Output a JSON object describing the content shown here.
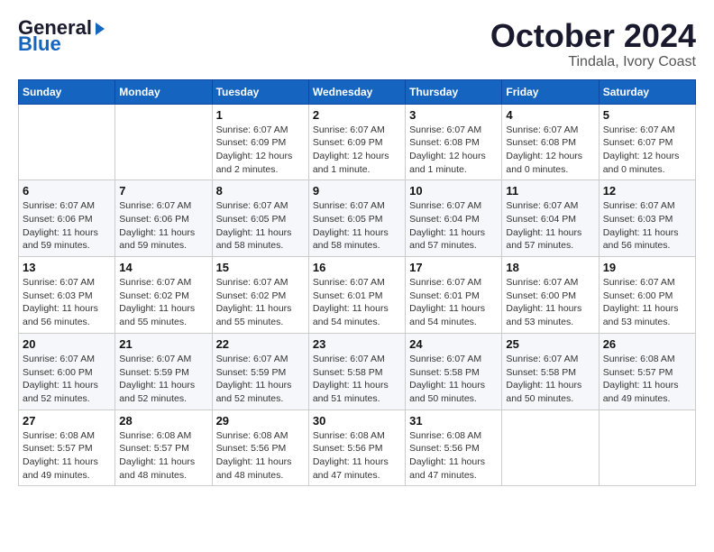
{
  "header": {
    "logo_line1": "General",
    "logo_line2": "Blue",
    "month_title": "October 2024",
    "location": "Tindala, Ivory Coast"
  },
  "weekdays": [
    "Sunday",
    "Monday",
    "Tuesday",
    "Wednesday",
    "Thursday",
    "Friday",
    "Saturday"
  ],
  "weeks": [
    [
      {
        "day": "",
        "info": ""
      },
      {
        "day": "",
        "info": ""
      },
      {
        "day": "1",
        "info": "Sunrise: 6:07 AM\nSunset: 6:09 PM\nDaylight: 12 hours\nand 2 minutes."
      },
      {
        "day": "2",
        "info": "Sunrise: 6:07 AM\nSunset: 6:09 PM\nDaylight: 12 hours\nand 1 minute."
      },
      {
        "day": "3",
        "info": "Sunrise: 6:07 AM\nSunset: 6:08 PM\nDaylight: 12 hours\nand 1 minute."
      },
      {
        "day": "4",
        "info": "Sunrise: 6:07 AM\nSunset: 6:08 PM\nDaylight: 12 hours\nand 0 minutes."
      },
      {
        "day": "5",
        "info": "Sunrise: 6:07 AM\nSunset: 6:07 PM\nDaylight: 12 hours\nand 0 minutes."
      }
    ],
    [
      {
        "day": "6",
        "info": "Sunrise: 6:07 AM\nSunset: 6:06 PM\nDaylight: 11 hours\nand 59 minutes."
      },
      {
        "day": "7",
        "info": "Sunrise: 6:07 AM\nSunset: 6:06 PM\nDaylight: 11 hours\nand 59 minutes."
      },
      {
        "day": "8",
        "info": "Sunrise: 6:07 AM\nSunset: 6:05 PM\nDaylight: 11 hours\nand 58 minutes."
      },
      {
        "day": "9",
        "info": "Sunrise: 6:07 AM\nSunset: 6:05 PM\nDaylight: 11 hours\nand 58 minutes."
      },
      {
        "day": "10",
        "info": "Sunrise: 6:07 AM\nSunset: 6:04 PM\nDaylight: 11 hours\nand 57 minutes."
      },
      {
        "day": "11",
        "info": "Sunrise: 6:07 AM\nSunset: 6:04 PM\nDaylight: 11 hours\nand 57 minutes."
      },
      {
        "day": "12",
        "info": "Sunrise: 6:07 AM\nSunset: 6:03 PM\nDaylight: 11 hours\nand 56 minutes."
      }
    ],
    [
      {
        "day": "13",
        "info": "Sunrise: 6:07 AM\nSunset: 6:03 PM\nDaylight: 11 hours\nand 56 minutes."
      },
      {
        "day": "14",
        "info": "Sunrise: 6:07 AM\nSunset: 6:02 PM\nDaylight: 11 hours\nand 55 minutes."
      },
      {
        "day": "15",
        "info": "Sunrise: 6:07 AM\nSunset: 6:02 PM\nDaylight: 11 hours\nand 55 minutes."
      },
      {
        "day": "16",
        "info": "Sunrise: 6:07 AM\nSunset: 6:01 PM\nDaylight: 11 hours\nand 54 minutes."
      },
      {
        "day": "17",
        "info": "Sunrise: 6:07 AM\nSunset: 6:01 PM\nDaylight: 11 hours\nand 54 minutes."
      },
      {
        "day": "18",
        "info": "Sunrise: 6:07 AM\nSunset: 6:00 PM\nDaylight: 11 hours\nand 53 minutes."
      },
      {
        "day": "19",
        "info": "Sunrise: 6:07 AM\nSunset: 6:00 PM\nDaylight: 11 hours\nand 53 minutes."
      }
    ],
    [
      {
        "day": "20",
        "info": "Sunrise: 6:07 AM\nSunset: 6:00 PM\nDaylight: 11 hours\nand 52 minutes."
      },
      {
        "day": "21",
        "info": "Sunrise: 6:07 AM\nSunset: 5:59 PM\nDaylight: 11 hours\nand 52 minutes."
      },
      {
        "day": "22",
        "info": "Sunrise: 6:07 AM\nSunset: 5:59 PM\nDaylight: 11 hours\nand 52 minutes."
      },
      {
        "day": "23",
        "info": "Sunrise: 6:07 AM\nSunset: 5:58 PM\nDaylight: 11 hours\nand 51 minutes."
      },
      {
        "day": "24",
        "info": "Sunrise: 6:07 AM\nSunset: 5:58 PM\nDaylight: 11 hours\nand 50 minutes."
      },
      {
        "day": "25",
        "info": "Sunrise: 6:07 AM\nSunset: 5:58 PM\nDaylight: 11 hours\nand 50 minutes."
      },
      {
        "day": "26",
        "info": "Sunrise: 6:08 AM\nSunset: 5:57 PM\nDaylight: 11 hours\nand 49 minutes."
      }
    ],
    [
      {
        "day": "27",
        "info": "Sunrise: 6:08 AM\nSunset: 5:57 PM\nDaylight: 11 hours\nand 49 minutes."
      },
      {
        "day": "28",
        "info": "Sunrise: 6:08 AM\nSunset: 5:57 PM\nDaylight: 11 hours\nand 48 minutes."
      },
      {
        "day": "29",
        "info": "Sunrise: 6:08 AM\nSunset: 5:56 PM\nDaylight: 11 hours\nand 48 minutes."
      },
      {
        "day": "30",
        "info": "Sunrise: 6:08 AM\nSunset: 5:56 PM\nDaylight: 11 hours\nand 47 minutes."
      },
      {
        "day": "31",
        "info": "Sunrise: 6:08 AM\nSunset: 5:56 PM\nDaylight: 11 hours\nand 47 minutes."
      },
      {
        "day": "",
        "info": ""
      },
      {
        "day": "",
        "info": ""
      }
    ]
  ]
}
